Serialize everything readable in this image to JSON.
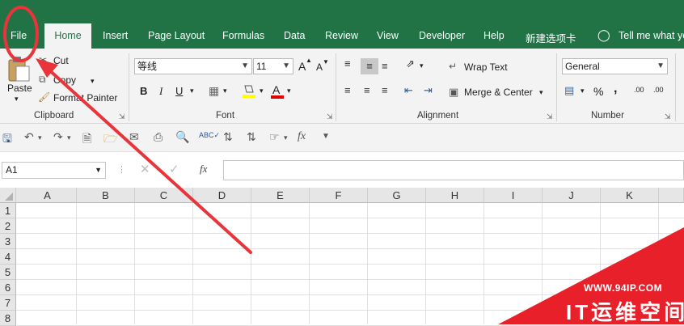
{
  "tabs": [
    "File",
    "Home",
    "Insert",
    "Page Layout",
    "Formulas",
    "Data",
    "Review",
    "View",
    "Developer",
    "Help",
    "新建选项卡"
  ],
  "tell_me": "Tell me what yo",
  "clipboard": {
    "paste": "Paste",
    "cut": "Cut",
    "copy": "Copy",
    "format_painter": "Format Painter",
    "label": "Clipboard"
  },
  "font": {
    "name": "等线",
    "size": "11",
    "grow": "A",
    "shrink": "A",
    "bold": "B",
    "italic": "I",
    "underline": "U",
    "label": "Font"
  },
  "alignment": {
    "wrap_text": "Wrap Text",
    "merge_center": "Merge & Center",
    "label": "Alignment"
  },
  "number": {
    "format": "General",
    "percent": "%",
    "comma": ",",
    "inc_decimal": ".00",
    "dec_decimal": ".00",
    "label": "Number"
  },
  "formula_bar": {
    "name_box": "A1",
    "fx": "fx"
  },
  "columns": [
    "A",
    "B",
    "C",
    "D",
    "E",
    "F",
    "G",
    "H",
    "I",
    "J",
    "K"
  ],
  "rows": [
    "1",
    "2",
    "3",
    "4",
    "5",
    "6",
    "7",
    "8"
  ],
  "watermark": {
    "url": "WWW.94IP.COM",
    "text": "IT运维空间"
  },
  "colors": {
    "ribbon_green": "#217346",
    "annotation_red": "#e8343a",
    "watermark_red": "#e8202a"
  }
}
